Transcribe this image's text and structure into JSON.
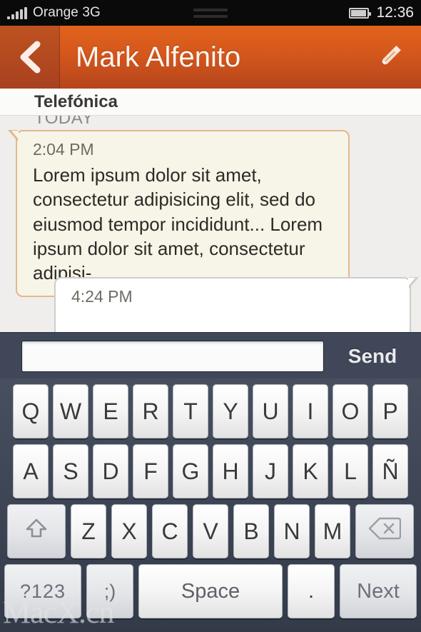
{
  "status_bar": {
    "carrier": "Orange 3G",
    "signal_icon": "signal-bars-icon",
    "center_indicator": "drag-handle-icon",
    "battery_icon": "battery-icon",
    "clock": "12:36"
  },
  "header": {
    "back_icon": "chevron-left-icon",
    "title": "Mark Alfenito",
    "edit_icon": "pencil-icon"
  },
  "conversation": {
    "contact_header": "Telefónica",
    "day_divider": "TODAY",
    "messages": [
      {
        "direction": "incoming",
        "time": "2:04 PM",
        "text": "Lorem ipsum dolor sit amet, consectetur adipisicing elit, sed do eiusmod tempor incididunt... Lorem ipsum dolor sit amet, consectetur adipisi-"
      },
      {
        "direction": "outgoing",
        "time": "4:24 PM",
        "text": ""
      }
    ]
  },
  "compose": {
    "input_value": "",
    "input_placeholder": "",
    "send_label": "Send"
  },
  "keyboard": {
    "row1": [
      "Q",
      "W",
      "E",
      "R",
      "T",
      "Y",
      "U",
      "I",
      "O",
      "P"
    ],
    "row2": [
      "A",
      "S",
      "D",
      "F",
      "G",
      "H",
      "J",
      "K",
      "L",
      "Ñ"
    ],
    "row3_letters": [
      "Z",
      "X",
      "C",
      "V",
      "B",
      "N",
      "M"
    ],
    "shift_icon": "shift-arrow-icon",
    "backspace_icon": "backspace-icon",
    "symbols_label": "?123",
    "emoji_label": ";)",
    "space_label": "Space",
    "period_label": ".",
    "next_label": "Next"
  },
  "watermark": "MacX.cn",
  "colors": {
    "header_orange": "#d4571c",
    "keyboard_slate": "#3c4454",
    "incoming_bubble": "#f7f4e8",
    "incoming_border": "#e3b98a",
    "outgoing_bubble": "#ffffff"
  }
}
